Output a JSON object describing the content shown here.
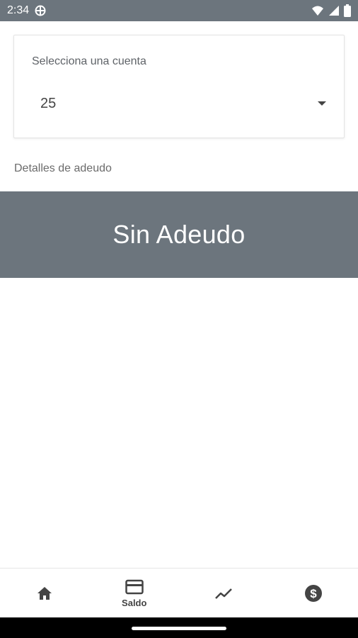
{
  "status_bar": {
    "time": "2:34",
    "icons": [
      "vpn-globe-icon",
      "wifi-icon",
      "signal-icon",
      "battery-icon"
    ]
  },
  "account_selector": {
    "label": "Selecciona una cuenta",
    "selected_value": "25"
  },
  "details": {
    "label": "Detalles de adeudo"
  },
  "debt_status": {
    "text": "Sin Adeudo"
  },
  "bottom_nav": {
    "items": [
      {
        "icon": "home-icon",
        "label": ""
      },
      {
        "icon": "card-icon",
        "label": "Saldo"
      },
      {
        "icon": "trending-icon",
        "label": ""
      },
      {
        "icon": "dollar-icon",
        "label": ""
      }
    ]
  },
  "colors": {
    "banner": "#6c757d",
    "status_bar": "#6c757d",
    "background": "#ffffff"
  }
}
